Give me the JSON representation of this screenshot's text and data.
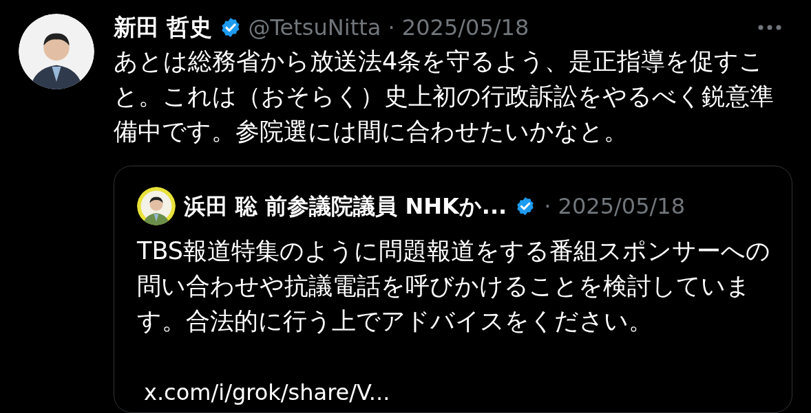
{
  "tweet": {
    "author": {
      "name": "新田 哲史",
      "verified": true,
      "meta": "@TetsuNitta · 2025/05/18"
    },
    "text": "あとは総務省から放送法4条を守るよう、是正指導を促すこと。これは（おそらく）史上初の行政訴訟をやるべく鋭意準備中です。参院選には間に合わせたいかなと。",
    "quote": {
      "author": {
        "name": "浜田 聡 前参議院議員 NHKか...",
        "verified": true,
        "meta": "· 2025/05/18"
      },
      "text": "TBS報道特集のように問題報道をする番組スポンサーへの問い合わせや抗議電話を呼びかけることを検討しています。合法的に行う上でアドバイスをください。",
      "link": "x.com/i/grok/share/V..."
    }
  }
}
